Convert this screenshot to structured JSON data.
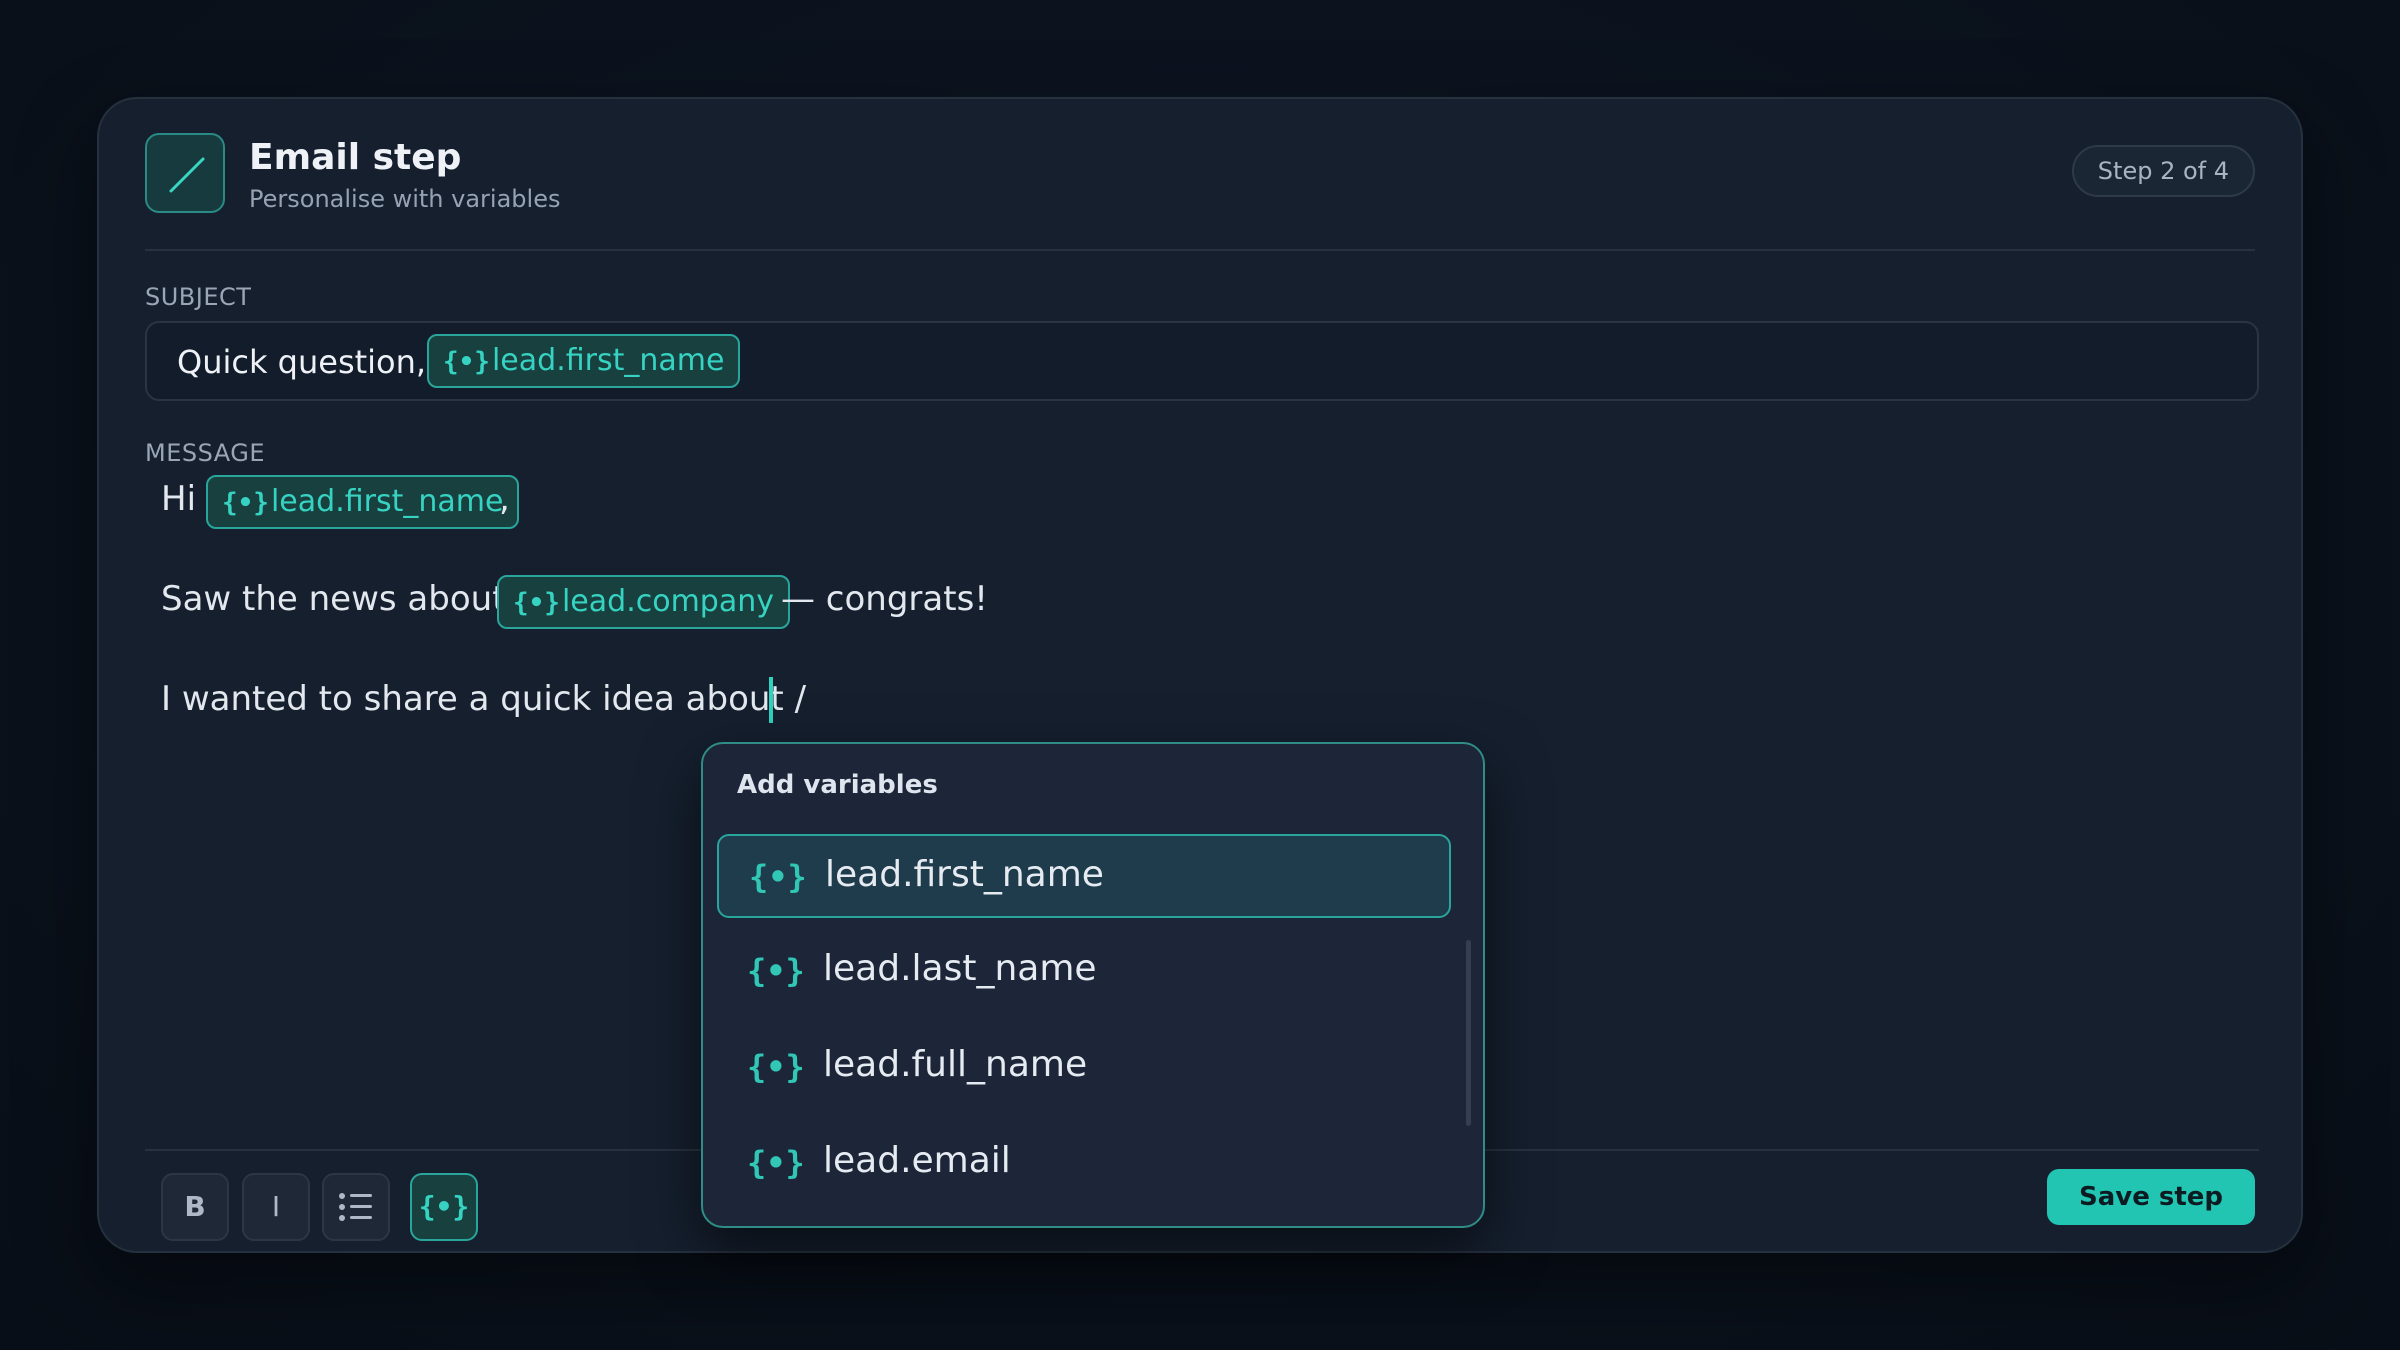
{
  "header": {
    "title": "Email step",
    "subtitle": "Personalise with variables",
    "step_badge": "Step 2 of 4",
    "logo_icon": "slash-icon"
  },
  "subject": {
    "label": "SUBJECT",
    "text": "Quick question,",
    "variable": "lead.first_name"
  },
  "message": {
    "label": "MESSAGE",
    "line1": {
      "before": "Hi",
      "variable": "lead.first_name",
      "after": ","
    },
    "line2": {
      "before": "Saw the news about",
      "variable": "lead.company",
      "after": "— congrats!"
    },
    "line3": {
      "text": "I wanted to share a quick idea about /"
    }
  },
  "variable_icon_glyph": "{•}",
  "dropdown": {
    "title": "Add variables",
    "items": [
      {
        "label": "lead.first_name",
        "active": true
      },
      {
        "label": "lead.last_name",
        "active": false
      },
      {
        "label": "lead.full_name",
        "active": false
      },
      {
        "label": "lead.email",
        "active": false
      }
    ]
  },
  "toolbar": {
    "bold_label": "B",
    "italic_label": "I",
    "list_icon": "list-icon",
    "variable_icon": "braces-icon",
    "save_label": "Save step"
  },
  "colors": {
    "accent": "#22c5b2",
    "chip_text": "#37d3c2",
    "card_bg": "#151f2e"
  }
}
